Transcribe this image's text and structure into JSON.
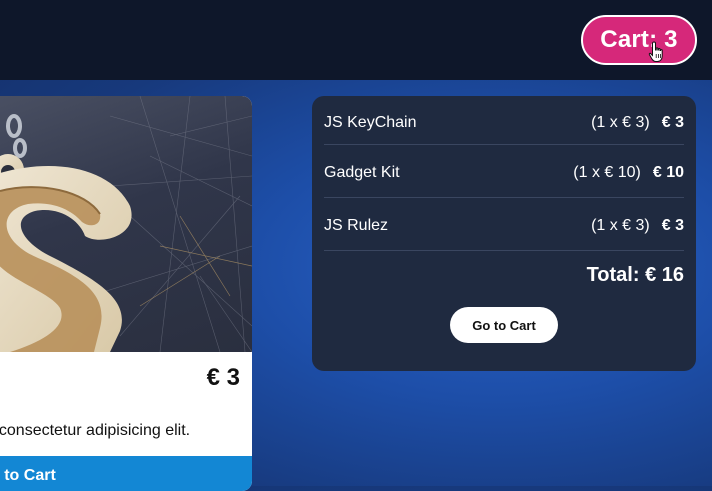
{
  "header": {
    "cart_button_label": "Cart: 3"
  },
  "product": {
    "image_alt": "S keychain",
    "price": "€ 3",
    "description": ", consectetur adipisicing elit.",
    "add_to_cart_label": "d to Cart"
  },
  "cart": {
    "items": [
      {
        "name": "JS KeyChain",
        "qty_price": "(1 x € 3)",
        "amount": "€ 3"
      },
      {
        "name": "Gadget Kit",
        "qty_price": "(1 x € 10)",
        "amount": "€ 10"
      },
      {
        "name": "JS Rulez",
        "qty_price": "(1 x € 3)",
        "amount": "€ 3"
      }
    ],
    "total": "Total: € 16",
    "go_to_cart_label": "Go to Cart"
  },
  "colors": {
    "cart_button": "#d6287a",
    "topbar": "#0e172a",
    "panel": "#1f2a40",
    "add_to_cart": "#1387d4"
  }
}
